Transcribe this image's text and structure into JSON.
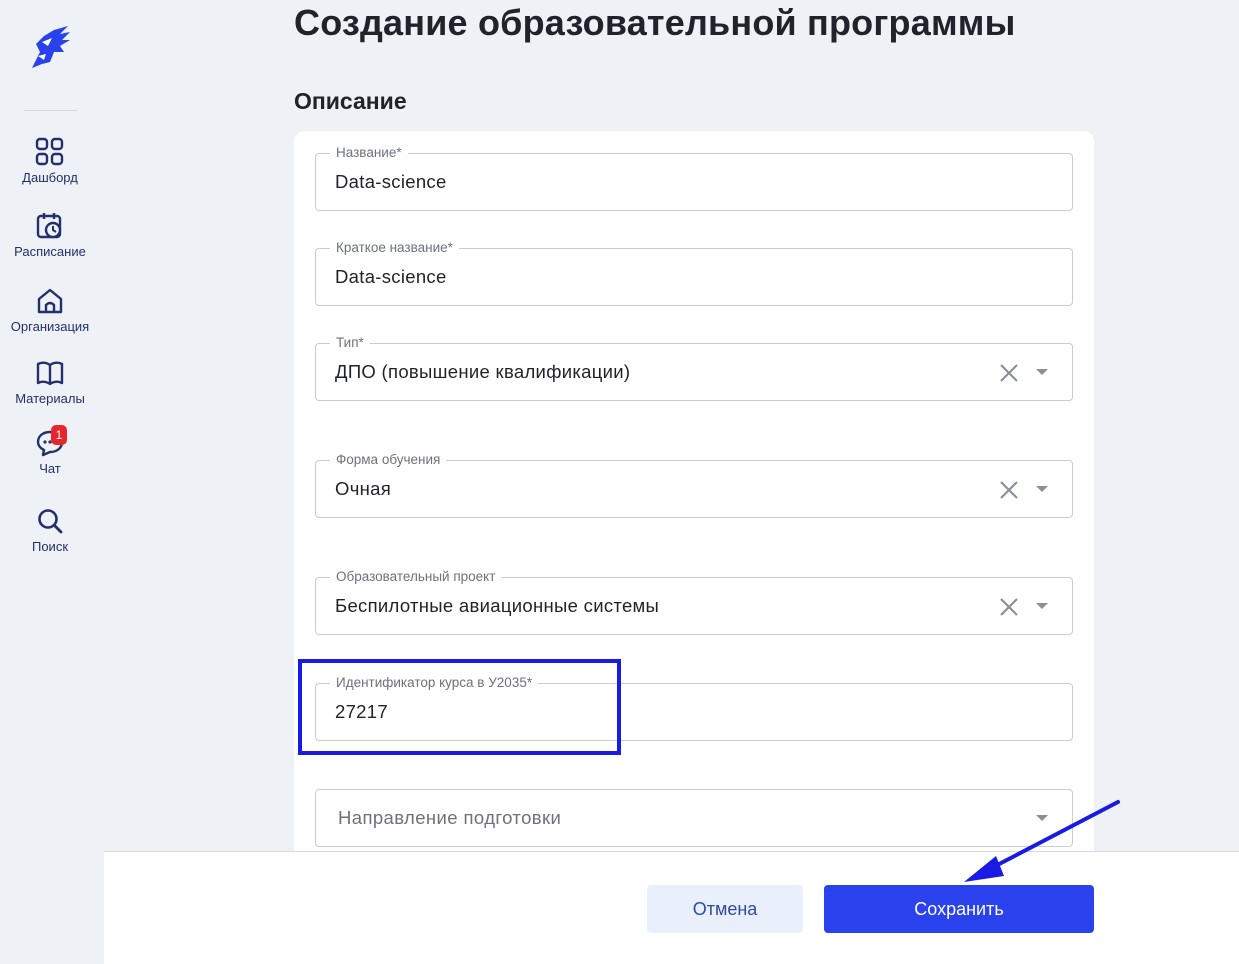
{
  "header": {
    "title": "Создание образовательной программы",
    "section_title": "Описание"
  },
  "sidebar": {
    "items": [
      {
        "label": "Дашборд",
        "icon": "grid-icon"
      },
      {
        "label": "Расписание",
        "icon": "calendar-clock-icon"
      },
      {
        "label": "Организация",
        "icon": "home-icon"
      },
      {
        "label": "Материалы",
        "icon": "book-icon"
      },
      {
        "label": "Чат",
        "icon": "chat-icon",
        "badge": "1"
      },
      {
        "label": "Поиск",
        "icon": "search-icon"
      }
    ]
  },
  "form": {
    "name": {
      "label": "Название*",
      "value": "Data-science"
    },
    "short_name": {
      "label": "Краткое название*",
      "value": "Data-science"
    },
    "type": {
      "label": "Тип*",
      "value": "ДПО (повышение квалификации)"
    },
    "study_form": {
      "label": "Форма обучения",
      "value": "Очная"
    },
    "edu_project": {
      "label": "Образовательный проект",
      "value": "Беспилотные авиационные системы"
    },
    "u2035_id": {
      "label": "Идентификатор курса в У2035*",
      "value": "27217"
    },
    "direction": {
      "placeholder": "Направление подготовки"
    }
  },
  "footer": {
    "cancel_label": "Отмена",
    "save_label": "Сохранить"
  },
  "colors": {
    "accent": "#2a41ee",
    "highlight": "#1a1ae6",
    "nav_text": "#23306b",
    "badge": "#e5262b"
  }
}
